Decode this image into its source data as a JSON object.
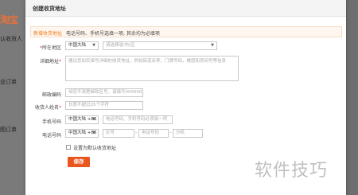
{
  "background": {
    "logo": "淘宝",
    "side_texts": [
      "认收货人",
      "业订单",
      "图订单"
    ]
  },
  "dialog": {
    "title": "创建收货地址"
  },
  "tabs": {
    "active": "新增收货地址",
    "hint": "电话号码、手机号选填一项, 其余均为必填项"
  },
  "form": {
    "region": {
      "label": "所在地区",
      "country": "中国大陆",
      "placeholder": "请选择省/市/区"
    },
    "address": {
      "label": "详细地址",
      "placeholder": "建议您如实填写详细的收货地址，例如街道名称，门牌号码，楼层和房间号等信息"
    },
    "postcode": {
      "label": "邮政编码",
      "placeholder": "如您不清楚邮政区号，请填写000000"
    },
    "name": {
      "label": "收货人姓名",
      "placeholder": "长度不超过25个字符"
    },
    "mobile": {
      "label": "手机号码",
      "country_code": "中国大陆 +86",
      "placeholder": "电话号码、手机号码必须填一项"
    },
    "phone": {
      "label": "电话号码",
      "country_code": "中国大陆 +86",
      "area_placeholder": "区号",
      "number_placeholder": "电话号码",
      "ext_placeholder": "分机",
      "sep": "-"
    },
    "default_checkbox": "设置为默认收货地址",
    "save_button": "保存"
  },
  "watermark": "软件技巧"
}
